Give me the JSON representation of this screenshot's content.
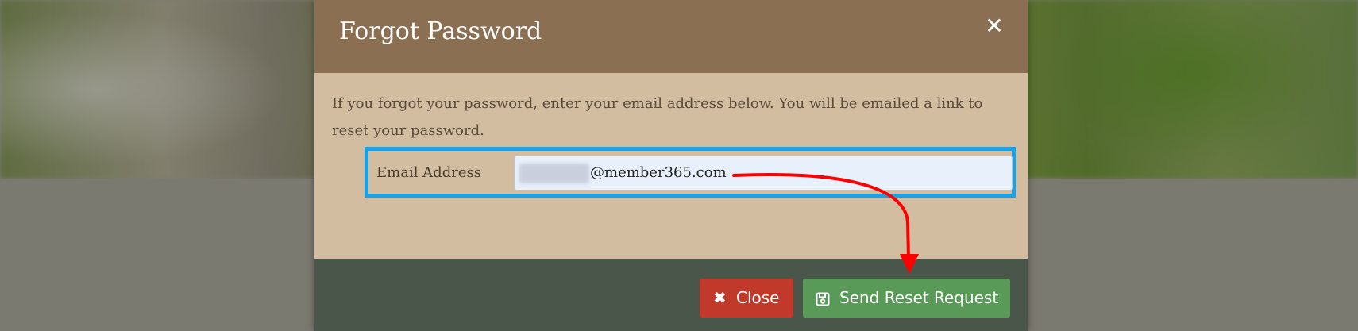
{
  "modal": {
    "title": "Forgot Password",
    "close_icon": "close-icon",
    "instructions": "If you forgot your password, enter your email address below. You will be emailed a link to reset your password.",
    "email_label": "Email Address",
    "email_value_visible": "@member365.com",
    "buttons": {
      "close_label": "Close",
      "close_icon": "times-icon",
      "send_label": "Send Reset Request",
      "send_icon": "floppy-disk-icon"
    }
  },
  "colors": {
    "header_bg": "#8b6f52",
    "body_bg": "#d2bda1",
    "footer_bg": "#4b564a",
    "close_button": "#c0392b",
    "send_button": "#5a9a58",
    "highlight_border": "#16a3e9",
    "annotation_arrow": "#ff0000",
    "input_bg": "#e8f0fc"
  }
}
